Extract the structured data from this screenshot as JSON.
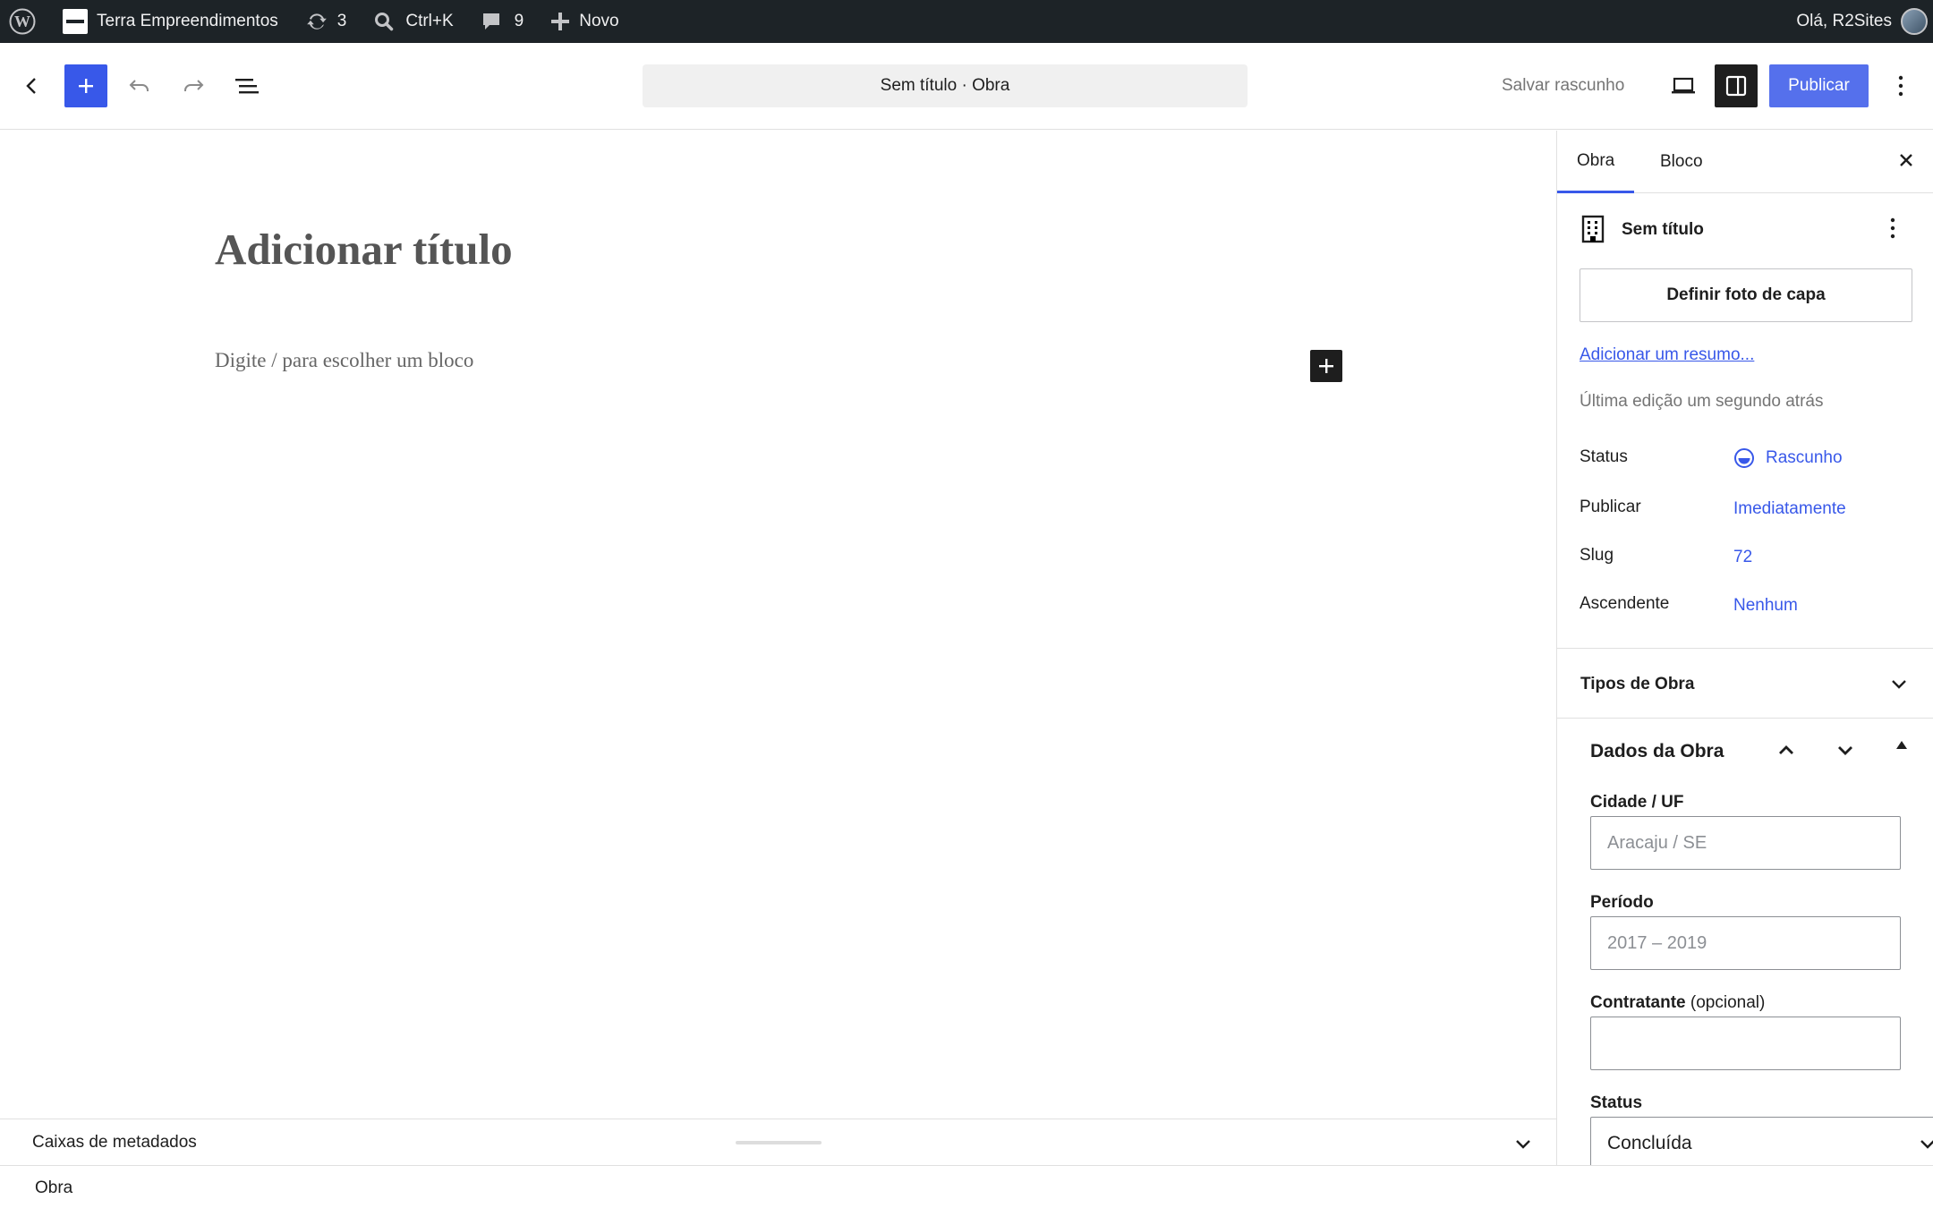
{
  "admin_bar": {
    "site_name": "Terra Empreendimentos",
    "updates_count": "3",
    "search_shortcut": "Ctrl+K",
    "comments_count": "9",
    "new_label": "Novo",
    "greeting": "Olá, R2Sites"
  },
  "header": {
    "document_title": "Sem título · Obra",
    "save_draft_label": "Salvar rascunho",
    "publish_label": "Publicar"
  },
  "canvas": {
    "title_placeholder": "Adicionar título",
    "block_placeholder": "Digite / para escolher um bloco"
  },
  "metabox": {
    "label": "Caixas de metadados"
  },
  "footer": {
    "breadcrumb": "Obra"
  },
  "sidebar": {
    "tabs": [
      {
        "label": "Obra",
        "active": true
      },
      {
        "label": "Bloco",
        "active": false
      }
    ],
    "post_card": {
      "title": "Sem título",
      "featured_image_label": "Definir foto de capa",
      "excerpt_link": "Adicionar um resumo...",
      "last_edited": "Última edição um segundo atrás"
    },
    "summary_rows": [
      {
        "label": "Status",
        "value": "Rascunho"
      },
      {
        "label": "Publicar",
        "value": "Imediatamente"
      },
      {
        "label": "Slug",
        "value": "72"
      },
      {
        "label": "Ascendente",
        "value": "Nenhum"
      }
    ],
    "tipos_panel": {
      "title": "Tipos de Obra"
    },
    "dados_panel": {
      "title": "Dados da Obra",
      "fields": [
        {
          "label": "Cidade / UF",
          "optional": "",
          "value": "",
          "placeholder": "Aracaju / SE"
        },
        {
          "label": "Período",
          "optional": "",
          "value": "",
          "placeholder": "2017 – 2019"
        },
        {
          "label": "Contratante",
          "optional": "(opcional)",
          "value": "",
          "placeholder": ""
        }
      ],
      "status_label": "Status",
      "status_selected": "Concluída"
    }
  },
  "colors": {
    "accent": "#3858e9",
    "admin_bar_bg": "#1d2327",
    "text": "#1e1e1e",
    "muted": "#757575"
  }
}
